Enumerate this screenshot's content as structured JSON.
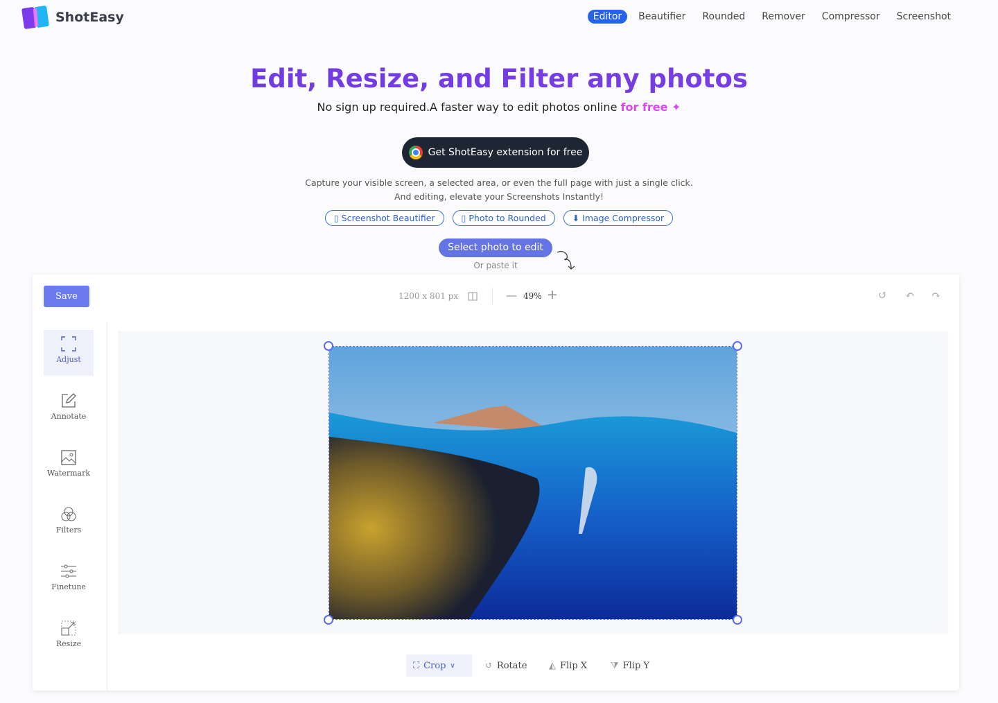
{
  "brand": {
    "name": "ShotEasy"
  },
  "nav": [
    {
      "label": "Editor",
      "active": true
    },
    {
      "label": "Beautifier"
    },
    {
      "label": "Rounded"
    },
    {
      "label": "Remover"
    },
    {
      "label": "Compressor"
    },
    {
      "label": "Screenshot"
    }
  ],
  "hero": {
    "title": "Edit, Resize, and Filter any photos",
    "subtitle": "No sign up required.A faster way to edit photos online ",
    "subtitle_highlight": "for free",
    "extension_button": "Get ShotEasy extension for free",
    "desc_line1": "Capture your visible screen, a selected area, or even the full page with just a single click.",
    "desc_line2": "And editing, elevate your Screenshots Instantly!",
    "pills": [
      "▯ Screenshot Beautifier",
      "▯ Photo to Rounded",
      "⬇ Image Compressor"
    ],
    "select_button": "Select photo to edit",
    "paste_hint": "Or paste it"
  },
  "editor": {
    "save": "Save",
    "dimensions": "1200 x 801 px",
    "zoom": "49%",
    "tools": [
      {
        "label": "Adjust",
        "icon": "crop-frame-icon",
        "active": true
      },
      {
        "label": "Annotate",
        "icon": "edit-icon"
      },
      {
        "label": "Watermark",
        "icon": "image-icon"
      },
      {
        "label": "Filters",
        "icon": "circles-icon"
      },
      {
        "label": "Finetune",
        "icon": "sliders-icon"
      },
      {
        "label": "Resize",
        "icon": "resize-icon"
      }
    ],
    "bottom": {
      "crop": "Crop",
      "rotate": "Rotate",
      "flipx": "Flip X",
      "flipy": "Flip Y"
    }
  },
  "colors": {
    "accent": "#6b7cf0",
    "title": "#6d3ae0",
    "nav_active": "#2563eb",
    "free": "#d946ef"
  }
}
